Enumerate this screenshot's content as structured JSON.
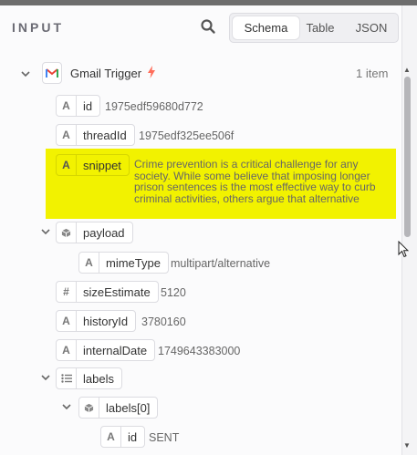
{
  "panel": {
    "title": "INPUT",
    "tabs": [
      {
        "label": "Schema",
        "active": true
      },
      {
        "label": "Table",
        "active": false
      },
      {
        "label": "JSON",
        "active": false
      }
    ]
  },
  "trigger": {
    "name": "Gmail Trigger",
    "count": "1 item",
    "icon": "gmail-icon",
    "badge_icon": "bolt-icon",
    "badge_color": "#ff6d5a"
  },
  "fields": {
    "id": {
      "type": "A",
      "key": "id",
      "value": "1975edf59680d772"
    },
    "threadId": {
      "type": "A",
      "key": "threadId",
      "value": "1975edf325ee506f"
    },
    "snippet": {
      "type": "A",
      "key": "snippet",
      "value": "Crime prevention is a critical challenge for any society. While some believe that imposing longer prison sentences is the most effective way to curb criminal activities, others argue that alternative"
    },
    "payload": {
      "type": "cube-icon",
      "key": "payload"
    },
    "mimeType": {
      "type": "A",
      "key": "mimeType",
      "value": "multipart/alternative"
    },
    "sizeEstimate": {
      "type": "#",
      "key": "sizeEstimate",
      "value": "5120"
    },
    "historyId": {
      "type": "A",
      "key": "historyId",
      "value": "3780160"
    },
    "internalDate": {
      "type": "A",
      "key": "internalDate",
      "value": "1749643383000"
    },
    "labels": {
      "type": "list-icon",
      "key": "labels"
    },
    "labels0": {
      "type": "cube-icon",
      "key": "labels[0]"
    },
    "labels0_id": {
      "type": "A",
      "key": "id",
      "value": "SENT"
    }
  },
  "colors": {
    "highlight": "#f2f200",
    "accent_bolt": "#ff6d5a"
  }
}
